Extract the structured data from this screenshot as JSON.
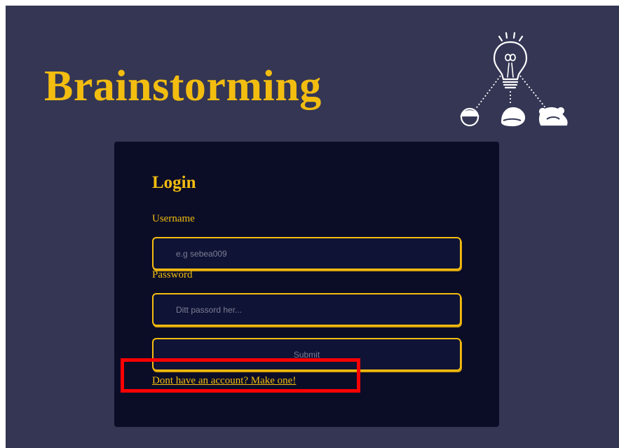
{
  "header": {
    "title": "Brainstorming",
    "logo_icon": "lightbulb-people-icon"
  },
  "login": {
    "heading": "Login",
    "username_label": "Username",
    "username_placeholder": "e.g sebea009",
    "password_label": "Password",
    "password_placeholder": "Ditt passord her...",
    "submit_label": "Submit",
    "signup_link": "Dont have an account? Make one!"
  },
  "colors": {
    "background": "#343654",
    "card": "#0b0d27",
    "accent": "#f3bd10",
    "input_bg": "#0f1336",
    "highlight": "#ff0000"
  }
}
